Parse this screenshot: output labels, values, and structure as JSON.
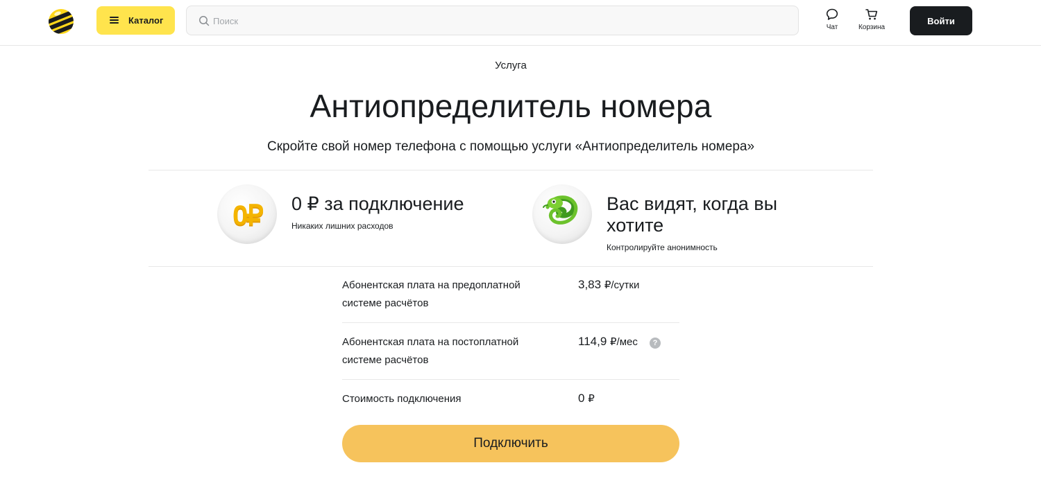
{
  "header": {
    "catalog_label": "Каталог",
    "search_placeholder": "Поиск",
    "chat_label": "Чат",
    "cart_label": "Корзина",
    "login_label": "Войти",
    "brand_color": "#ffd71a"
  },
  "hero": {
    "eyebrow": "Услуга",
    "title": "Антиопределитель номера",
    "subtitle": "Скройте свой номер телефона с помощью услуги «Антиопределитель номера»"
  },
  "features": [
    {
      "icon": "zero-ruble-coin-icon",
      "icon_text": "0₽",
      "title": "0 ₽ за подключение",
      "subtitle": "Никаких лишних расходов"
    },
    {
      "icon": "chameleon-icon",
      "title_line1": "Вас видят, когда вы",
      "title_line2": "хотите",
      "subtitle": "Контролируйте анонимность"
    }
  ],
  "prices": [
    {
      "label_line1": "Абонентская плата на предоплатной",
      "label_line2": "системе расчётов",
      "value": "3,83",
      "unit": "₽/сутки"
    },
    {
      "label_line1": "Абонентская плата на постоплатной",
      "label_line2": "системе расчётов",
      "value": "114,9",
      "unit": "₽/мес",
      "help": "?"
    },
    {
      "label_line1": "Стоимость подключения",
      "value": "0",
      "unit": "₽"
    }
  ],
  "cta": {
    "label": "Подключить",
    "color": "#f6c35c"
  }
}
